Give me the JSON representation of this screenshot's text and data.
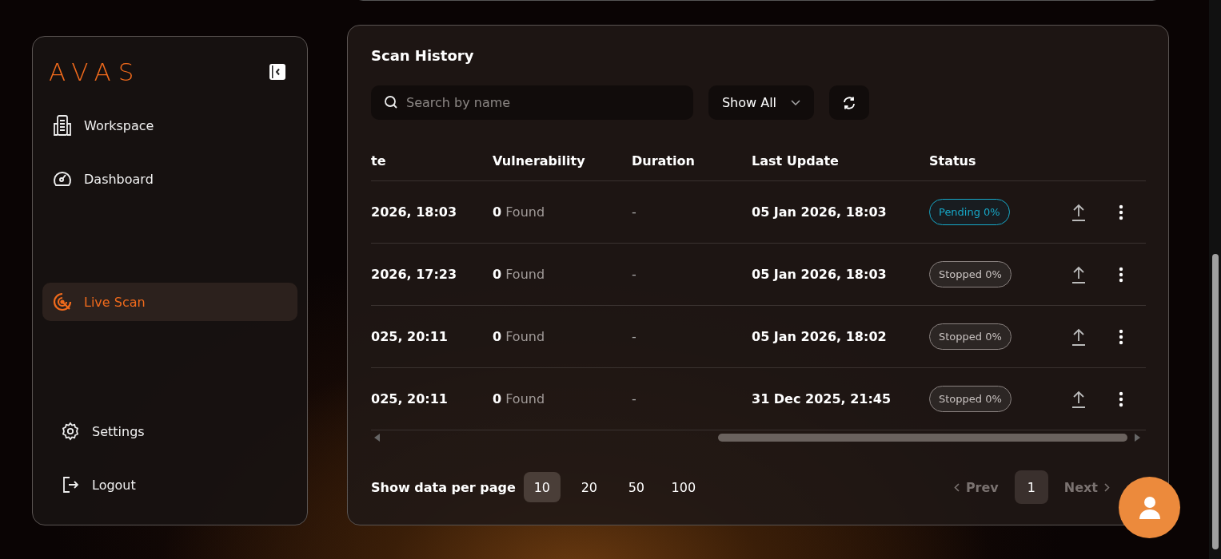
{
  "sidebar": {
    "logo": "AVAS",
    "nav_items": [
      {
        "label": "Workspace",
        "selected": false
      },
      {
        "label": "Dashboard",
        "selected": false
      },
      {
        "label": "Live Scan",
        "selected": true
      }
    ],
    "bottom_items": [
      {
        "label": "Settings"
      },
      {
        "label": "Logout"
      }
    ]
  },
  "scan_history": {
    "title": "Scan History",
    "search": {
      "placeholder": "Search by name"
    },
    "filter": {
      "value": "Show All"
    },
    "table": {
      "columns": [
        "te",
        "Vulnerability",
        "Duration",
        "Last Update",
        "Status"
      ],
      "rows": [
        {
          "column_1": "2026, 18:03",
          "vulnerability": "**0** Found",
          "duration": "-",
          "last_update": "05 Jan 2026, 18:03",
          "status": {
            "label": "Pending 0%",
            "kind": "pending"
          }
        },
        {
          "column_1": "2026, 17:23",
          "vulnerability": "**0** Found",
          "duration": "-",
          "last_update": "05 Jan 2026, 18:03",
          "status": {
            "label": "Stopped 0%",
            "kind": "stopped"
          }
        },
        {
          "column_1": "025, 20:11",
          "vulnerability": "**0** Found",
          "duration": "-",
          "last_update": "05 Jan 2026, 18:02",
          "status": {
            "label": "Stopped 0%",
            "kind": "stopped"
          }
        },
        {
          "column_1": "025, 20:11",
          "vulnerability": "**0** Found",
          "duration": "-",
          "last_update": "31 Dec 2025, 21:45",
          "status": {
            "label": "Stopped 0%",
            "kind": "stopped"
          }
        }
      ]
    },
    "per_page": {
      "label": "Show data per page",
      "options": [
        {
          "label": "10",
          "selected": true
        },
        {
          "label": "20",
          "selected": false
        },
        {
          "label": "50",
          "selected": false
        },
        {
          "label": "100",
          "selected": false
        }
      ]
    },
    "pagination": {
      "prev": {
        "label": "Prev",
        "disabled": true
      },
      "pages": [
        {
          "label": "1",
          "selected": true
        }
      ],
      "next": {
        "label": "Next",
        "disabled": true
      }
    }
  }
}
